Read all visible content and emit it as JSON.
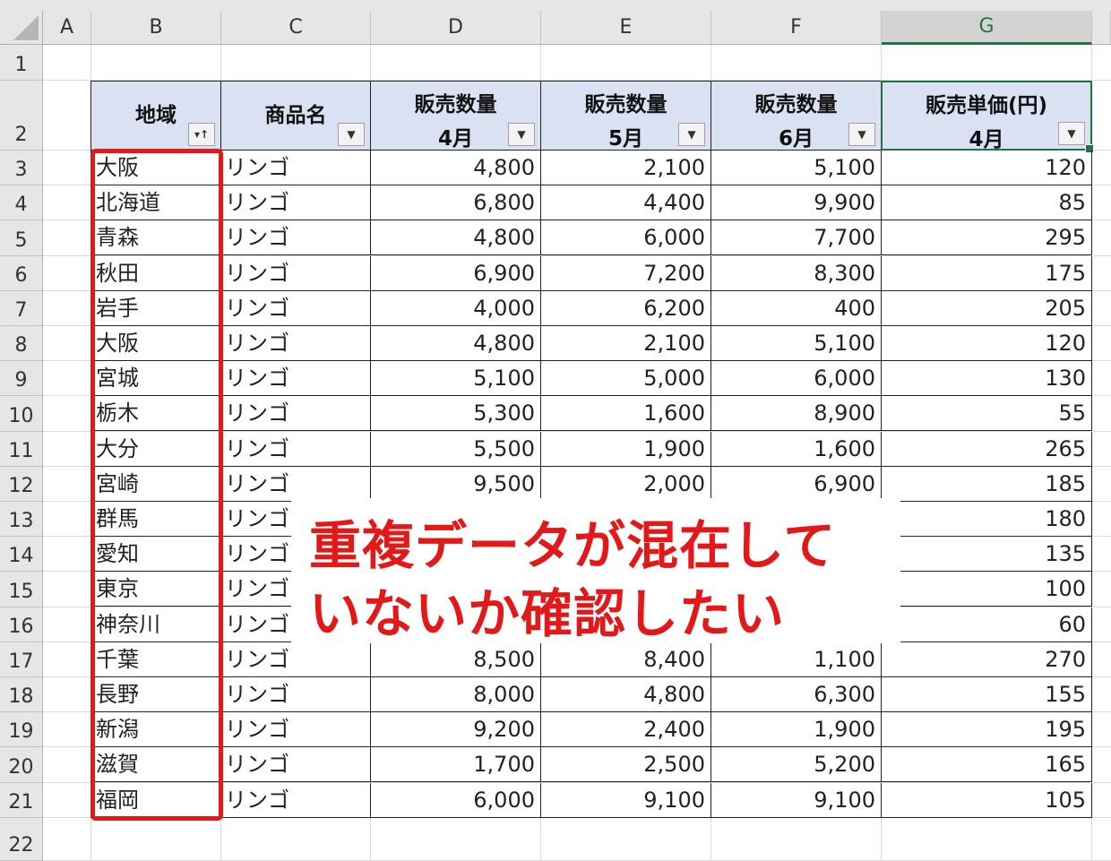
{
  "column_headers": [
    "A",
    "B",
    "C",
    "D",
    "E",
    "F",
    "G"
  ],
  "selected_column": "G",
  "row_numbers": [
    "1",
    "2",
    "3",
    "4",
    "5",
    "6",
    "7",
    "8",
    "9",
    "10",
    "11",
    "12",
    "13",
    "14",
    "15",
    "16",
    "17",
    "18",
    "19",
    "20",
    "21",
    "22"
  ],
  "table_header": {
    "region": "地域",
    "product": "商品名",
    "qty_apr": [
      "販売数量",
      "4月"
    ],
    "qty_may": [
      "販売数量",
      "5月"
    ],
    "qty_jun": [
      "販売数量",
      "6月"
    ],
    "unit_price_apr": [
      "販売単価(円)",
      "4月"
    ]
  },
  "rows": [
    {
      "region": "大阪",
      "product": "リンゴ",
      "d": "4,800",
      "e": "2,100",
      "f": "5,100",
      "g": "120"
    },
    {
      "region": "北海道",
      "product": "リンゴ",
      "d": "6,800",
      "e": "4,400",
      "f": "9,900",
      "g": "85"
    },
    {
      "region": "青森",
      "product": "リンゴ",
      "d": "4,800",
      "e": "6,000",
      "f": "7,700",
      "g": "295"
    },
    {
      "region": "秋田",
      "product": "リンゴ",
      "d": "6,900",
      "e": "7,200",
      "f": "8,300",
      "g": "175"
    },
    {
      "region": "岩手",
      "product": "リンゴ",
      "d": "4,000",
      "e": "6,200",
      "f": "400",
      "g": "205"
    },
    {
      "region": "大阪",
      "product": "リンゴ",
      "d": "4,800",
      "e": "2,100",
      "f": "5,100",
      "g": "120"
    },
    {
      "region": "宮城",
      "product": "リンゴ",
      "d": "5,100",
      "e": "5,000",
      "f": "6,000",
      "g": "130"
    },
    {
      "region": "栃木",
      "product": "リンゴ",
      "d": "5,300",
      "e": "1,600",
      "f": "8,900",
      "g": "55"
    },
    {
      "region": "大分",
      "product": "リンゴ",
      "d": "5,500",
      "e": "1,900",
      "f": "1,600",
      "g": "265"
    },
    {
      "region": "宮崎",
      "product": "リンゴ",
      "d": "9,500",
      "e": "2,000",
      "f": "6,900",
      "g": "185"
    },
    {
      "region": "群馬",
      "product": "リンゴ",
      "d": "",
      "e": "",
      "f": "",
      "g": "180"
    },
    {
      "region": "愛知",
      "product": "リンゴ",
      "d": "",
      "e": "",
      "f": "",
      "g": "135"
    },
    {
      "region": "東京",
      "product": "リンゴ",
      "d": "",
      "e": "",
      "f": "",
      "g": "100"
    },
    {
      "region": "神奈川",
      "product": "リンゴ",
      "d": "",
      "e": "",
      "f": "",
      "g": "60"
    },
    {
      "region": "千葉",
      "product": "リンゴ",
      "d": "8,500",
      "e": "8,400",
      "f": "1,100",
      "g": "270"
    },
    {
      "region": "長野",
      "product": "リンゴ",
      "d": "8,000",
      "e": "4,800",
      "f": "6,300",
      "g": "155"
    },
    {
      "region": "新潟",
      "product": "リンゴ",
      "d": "9,200",
      "e": "2,400",
      "f": "1,900",
      "g": "195"
    },
    {
      "region": "滋賀",
      "product": "リンゴ",
      "d": "1,700",
      "e": "2,500",
      "f": "5,200",
      "g": "165"
    },
    {
      "region": "福岡",
      "product": "リンゴ",
      "d": "6,000",
      "e": "9,100",
      "f": "9,100",
      "g": "105"
    }
  ],
  "annotation": [
    "重複データが混在して",
    "いないか確認したい"
  ],
  "colors": {
    "header_fill": "#d9e1f2",
    "selection": "#217346",
    "annotation": "#e31818"
  },
  "icons": {
    "region_filter": "filter-sort-ascending-icon",
    "other_filters": "filter-dropdown-icon"
  }
}
